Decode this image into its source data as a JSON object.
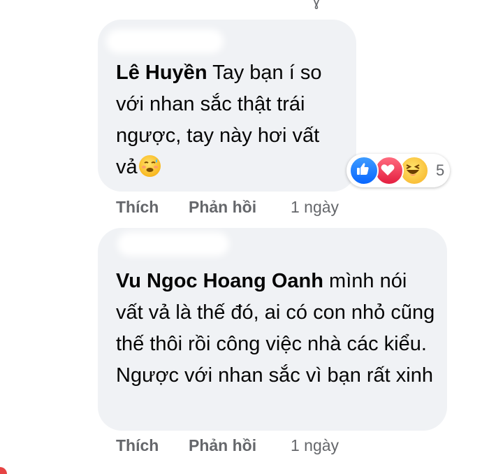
{
  "comments": [
    {
      "author": "Lê Huyền",
      "text": "Tay bạn í so với nhan sắc thật trái ngược, tay này hơi vất vả",
      "emoji": "sweating-face-emoji",
      "reactions": {
        "icons": [
          "like-icon",
          "love-icon",
          "haha-icon"
        ],
        "count": "5"
      },
      "actions": {
        "like": "Thích",
        "reply": "Phản hồi",
        "time": "1 ngày"
      }
    },
    {
      "author": "Vu Ngoc Hoang Oanh",
      "text": "mình nói vất vả là thế đó, ai có con nhỏ cũng thế thôi rồi công việc nhà các kiểu. Ngược với nhan sắc vì bạn rất xinh",
      "actions": {
        "like": "Thích",
        "reply": "Phản hồi",
        "time": "1 ngày"
      }
    }
  ],
  "colors": {
    "bubble": "#f0f2f5",
    "meta_text": "#65676b",
    "like_blue": "#0866ff",
    "love_red": "#e41e3f",
    "haha_yellow": "#f7b125"
  }
}
